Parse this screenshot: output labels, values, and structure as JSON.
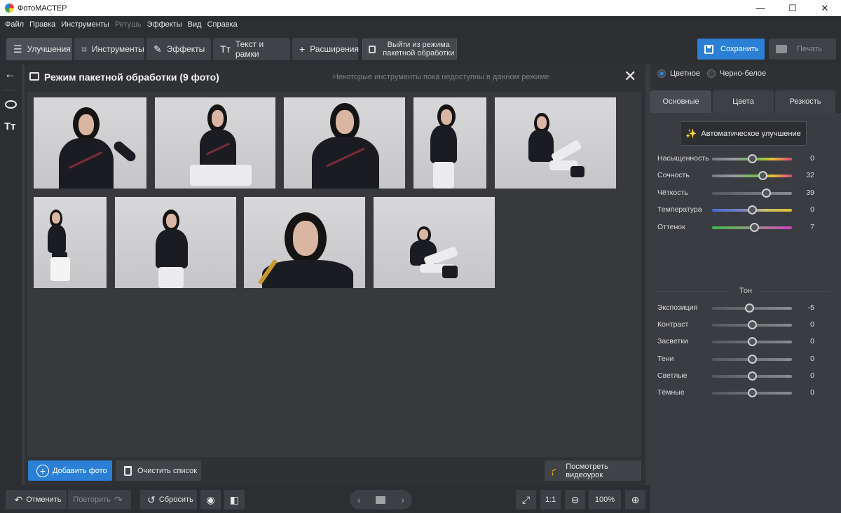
{
  "window": {
    "title": "ФотоМАСТЕР",
    "controls": [
      "—",
      "☐",
      "✕"
    ]
  },
  "menu": [
    {
      "label": "Файл",
      "disabled": false
    },
    {
      "label": "Правка",
      "disabled": false
    },
    {
      "label": "Инструменты",
      "disabled": false
    },
    {
      "label": "Ретушь",
      "disabled": true
    },
    {
      "label": "Эффекты",
      "disabled": false
    },
    {
      "label": "Вид",
      "disabled": false
    },
    {
      "label": "Справка",
      "disabled": false
    }
  ],
  "toolbar": {
    "tabs": [
      {
        "label": "Улучшения",
        "icon": "sliders-icon",
        "glyph": "☰",
        "active": true
      },
      {
        "label": "Инструменты",
        "icon": "crop-icon",
        "glyph": "⌗",
        "active": false
      },
      {
        "label": "Эффекты",
        "icon": "magic-wand-icon",
        "glyph": "✎",
        "active": false
      },
      {
        "label": "Текст и рамки",
        "icon": "text-icon",
        "glyph": "Тт",
        "active": false
      },
      {
        "label": "Расширения",
        "icon": "plus-icon",
        "glyph": "+",
        "active": false
      }
    ],
    "exit_batch": "Выйти из режима пакетной обработки",
    "save_label": "Сохранить",
    "print_label": "Печать"
  },
  "left_tools": {
    "back_glyph": "←",
    "text_glyph": "Tт"
  },
  "batch": {
    "title": "Режим пакетной обработки (9 фото)",
    "note": "Некоторые инструменты пока недоступны в данном режиме",
    "close_glyph": "✕",
    "photo_count": 9,
    "add_label": "Добавить фото",
    "clear_label": "Очистить список",
    "video_label": "Посмотреть видеоурок"
  },
  "bottom": {
    "undo_label": "Отменить",
    "redo_label": "Повторить",
    "reset_label": "Сбросить",
    "ratio_label": "1:1",
    "zoom": "100%"
  },
  "right_panel": {
    "color_mode": [
      {
        "label": "Цветное",
        "selected": true
      },
      {
        "label": "Черно-белое",
        "selected": false
      }
    ],
    "tabs": [
      {
        "label": "Основные",
        "active": true
      },
      {
        "label": "Цвета",
        "active": false
      },
      {
        "label": "Резкость",
        "active": false
      }
    ],
    "auto_label": "Автоматическое улучшение",
    "sliders": [
      {
        "label": "Насыщенность",
        "value": "0",
        "pos": 0.5,
        "track": "saturation"
      },
      {
        "label": "Сочность",
        "value": "32",
        "pos": 0.64,
        "track": "saturation"
      },
      {
        "label": "Чёткость",
        "value": "39",
        "pos": 0.68,
        "track": "gray"
      },
      {
        "label": "Температура",
        "value": "0",
        "pos": 0.5,
        "track": "temperature"
      },
      {
        "label": "Оттенок",
        "value": "7",
        "pos": 0.53,
        "track": "tint"
      }
    ],
    "tone_label": "Тон",
    "tone_sliders": [
      {
        "label": "Экспозиция",
        "value": "-5",
        "pos": 0.47
      },
      {
        "label": "Контраст",
        "value": "0",
        "pos": 0.5
      },
      {
        "label": "Засветки",
        "value": "0",
        "pos": 0.5
      },
      {
        "label": "Тени",
        "value": "0",
        "pos": 0.5
      },
      {
        "label": "Светлые",
        "value": "0",
        "pos": 0.5
      },
      {
        "label": "Тёмные",
        "value": "0",
        "pos": 0.5
      }
    ]
  },
  "colors": {
    "accent": "#2b7fd4",
    "panel": "#2f3135",
    "chrome": "#2c2e32"
  }
}
